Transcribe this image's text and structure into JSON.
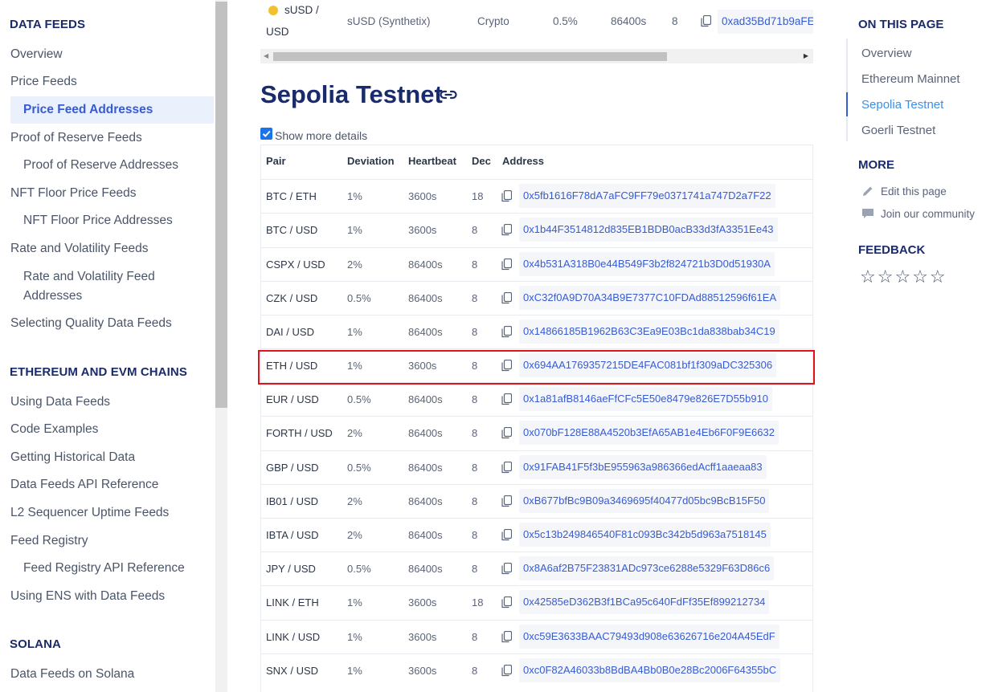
{
  "sidebar": {
    "sections": [
      {
        "title": "DATA FEEDS"
      },
      {
        "title": "ETHEREUM AND EVM CHAINS"
      },
      {
        "title": "SOLANA"
      }
    ],
    "items": [
      {
        "label": "Overview"
      },
      {
        "label": "Price Feeds"
      },
      {
        "label": "Price Feed Addresses"
      },
      {
        "label": "Proof of Reserve Feeds"
      },
      {
        "label": "Proof of Reserve Addresses"
      },
      {
        "label": "NFT Floor Price Feeds"
      },
      {
        "label": "NFT Floor Price Addresses"
      },
      {
        "label": "Rate and Volatility Feeds"
      },
      {
        "label": "Rate and Volatility Feed Addresses"
      },
      {
        "label": "Selecting Quality Data Feeds"
      },
      {
        "label": "Using Data Feeds"
      },
      {
        "label": "Code Examples"
      },
      {
        "label": "Getting Historical Data"
      },
      {
        "label": "Data Feeds API Reference"
      },
      {
        "label": "L2 Sequencer Uptime Feeds"
      },
      {
        "label": "Feed Registry"
      },
      {
        "label": "Feed Registry API Reference"
      },
      {
        "label": "Using ENS with Data Feeds"
      },
      {
        "label": "Data Feeds on Solana"
      }
    ]
  },
  "previous_table_row": {
    "pair_line1": "sUSD /",
    "pair_line2": "USD",
    "asset": "sUSD (Synthetix)",
    "type": "Crypto",
    "deviation": "0.5%",
    "heartbeat": "86400s",
    "dec": "8",
    "address": "0xad35Bd71b9aFE("
  },
  "main": {
    "title": "Sepolia Testnet",
    "show_more_label": "Show more details",
    "show_more_checked": true,
    "headers": {
      "pair": "Pair",
      "deviation": "Deviation",
      "heartbeat": "Heartbeat",
      "dec": "Dec",
      "address": "Address"
    },
    "rows": [
      {
        "pair": "BTC / ETH",
        "deviation": "1%",
        "heartbeat": "3600s",
        "dec": "18",
        "address": "0x5fb1616F78dA7aFC9FF79e0371741a747D2a7F22"
      },
      {
        "pair": "BTC / USD",
        "deviation": "1%",
        "heartbeat": "3600s",
        "dec": "8",
        "address": "0x1b44F3514812d835EB1BDB0acB33d3fA3351Ee43"
      },
      {
        "pair": "CSPX / USD",
        "deviation": "2%",
        "heartbeat": "86400s",
        "dec": "8",
        "address": "0x4b531A318B0e44B549F3b2f824721b3D0d51930A"
      },
      {
        "pair": "CZK / USD",
        "deviation": "0.5%",
        "heartbeat": "86400s",
        "dec": "8",
        "address": "0xC32f0A9D70A34B9E7377C10FDAd88512596f61EA"
      },
      {
        "pair": "DAI / USD",
        "deviation": "1%",
        "heartbeat": "86400s",
        "dec": "8",
        "address": "0x14866185B1962B63C3Ea9E03Bc1da838bab34C19"
      },
      {
        "pair": "ETH / USD",
        "deviation": "1%",
        "heartbeat": "3600s",
        "dec": "8",
        "address": "0x694AA1769357215DE4FAC081bf1f309aDC325306"
      },
      {
        "pair": "EUR / USD",
        "deviation": "0.5%",
        "heartbeat": "86400s",
        "dec": "8",
        "address": "0x1a81afB8146aeFfCFc5E50e8479e826E7D55b910"
      },
      {
        "pair": "FORTH / USD",
        "deviation": "2%",
        "heartbeat": "86400s",
        "dec": "8",
        "address": "0x070bF128E88A4520b3EfA65AB1e4Eb6F0F9E6632"
      },
      {
        "pair": "GBP / USD",
        "deviation": "0.5%",
        "heartbeat": "86400s",
        "dec": "8",
        "address": "0x91FAB41F5f3bE955963a986366edAcff1aaeaa83"
      },
      {
        "pair": "IB01 / USD",
        "deviation": "2%",
        "heartbeat": "86400s",
        "dec": "8",
        "address": "0xB677bfBc9B09a3469695f40477d05bc9BcB15F50"
      },
      {
        "pair": "IBTA / USD",
        "deviation": "2%",
        "heartbeat": "86400s",
        "dec": "8",
        "address": "0x5c13b249846540F81c093Bc342b5d963a7518145"
      },
      {
        "pair": "JPY / USD",
        "deviation": "0.5%",
        "heartbeat": "86400s",
        "dec": "8",
        "address": "0x8A6af2B75F23831ADc973ce6288e5329F63D86c6"
      },
      {
        "pair": "LINK / ETH",
        "deviation": "1%",
        "heartbeat": "3600s",
        "dec": "18",
        "address": "0x42585eD362B3f1BCa95c640FdFf35Ef899212734"
      },
      {
        "pair": "LINK / USD",
        "deviation": "1%",
        "heartbeat": "3600s",
        "dec": "8",
        "address": "0xc59E3633BAAC79493d908e63626716e204A45EdF"
      },
      {
        "pair": "SNX / USD",
        "deviation": "1%",
        "heartbeat": "3600s",
        "dec": "8",
        "address": "0xc0F82A46033b8BdBA4Bb0B0e28Bc2006F64355bC"
      }
    ]
  },
  "right": {
    "on_this_page_title": "ON THIS PAGE",
    "toc": [
      {
        "label": "Overview"
      },
      {
        "label": "Ethereum Mainnet"
      },
      {
        "label": "Sepolia Testnet"
      },
      {
        "label": "Goerli Testnet"
      }
    ],
    "more_title": "MORE",
    "edit_label": "Edit this page",
    "community_label": "Join our community",
    "feedback_title": "FEEDBACK",
    "stars": "☆☆☆☆☆"
  },
  "colors": {
    "accent": "#375bd2",
    "heading": "#1a2b6b",
    "highlight_border": "#e0121b",
    "active_bg": "#eaf1fd"
  }
}
